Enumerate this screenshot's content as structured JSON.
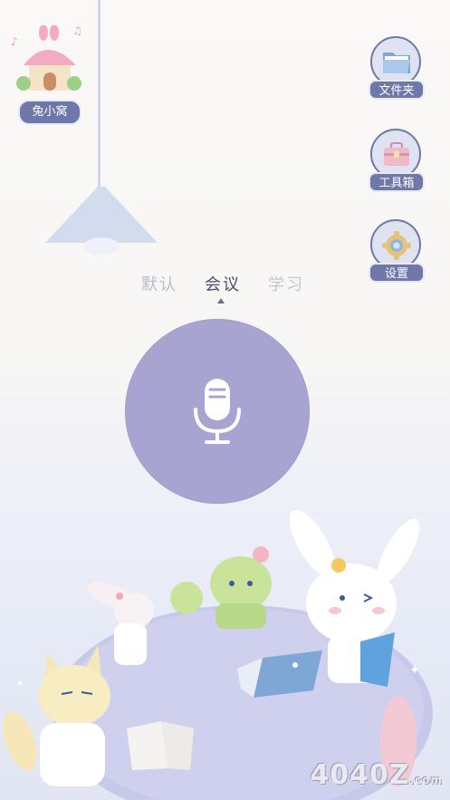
{
  "home": {
    "label": "兔小窝",
    "icon": "house-icon"
  },
  "tools": [
    {
      "label": "文件夹",
      "icon": "folder-icon"
    },
    {
      "label": "工具箱",
      "icon": "toolbox-icon"
    },
    {
      "label": "设置",
      "icon": "gear-icon"
    }
  ],
  "modes": {
    "default": "默认",
    "meeting": "会议",
    "study": "学习",
    "selected": "会议"
  },
  "record": {
    "icon": "microphone-icon"
  },
  "watermark": {
    "text": "4040Z",
    "suffix": ".com"
  },
  "colors": {
    "accent": "#6f78a8",
    "record": "#a7a4d1",
    "table": "#c8c9ea"
  }
}
